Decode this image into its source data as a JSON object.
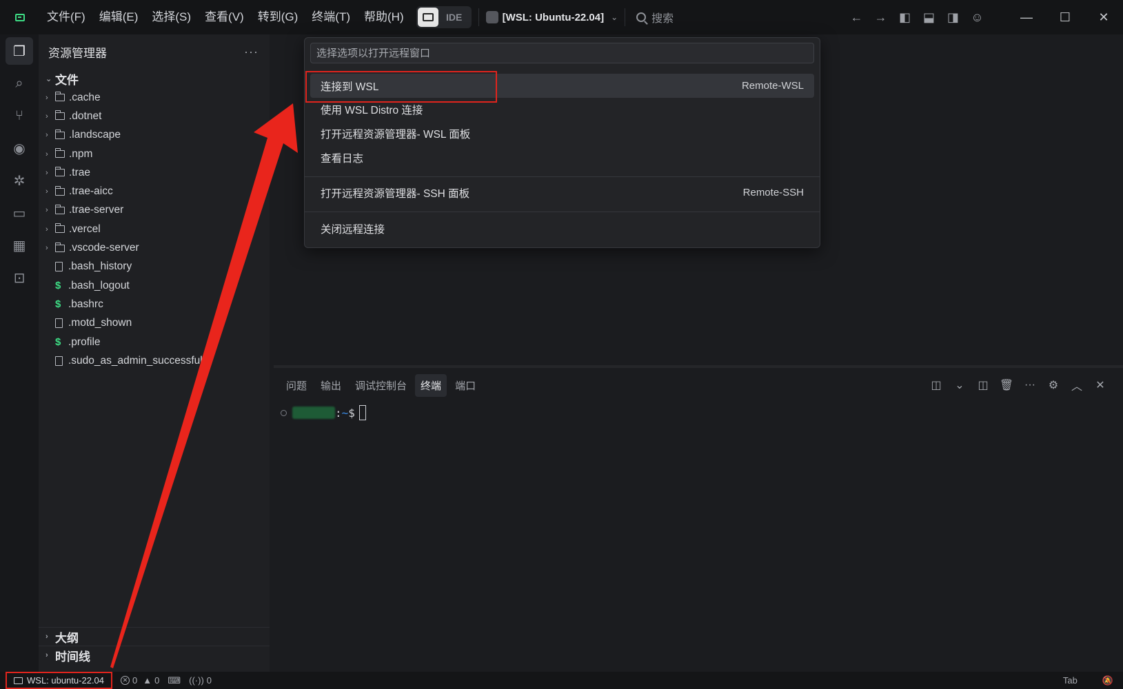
{
  "menu": [
    "文件(F)",
    "编辑(E)",
    "选择(S)",
    "查看(V)",
    "转到(G)",
    "终端(T)",
    "帮助(H)"
  ],
  "ide_label": "IDE",
  "project_name": "[WSL: Ubuntu-22.04]",
  "search_placeholder": "搜索",
  "sidebar": {
    "title": "资源管理器",
    "more": "···",
    "root": "文件",
    "items": [
      {
        "name": ".cache",
        "kind": "folder"
      },
      {
        "name": ".dotnet",
        "kind": "folder"
      },
      {
        "name": ".landscape",
        "kind": "folder"
      },
      {
        "name": ".npm",
        "kind": "folder"
      },
      {
        "name": ".trae",
        "kind": "folder"
      },
      {
        "name": ".trae-aicc",
        "kind": "folder"
      },
      {
        "name": ".trae-server",
        "kind": "folder"
      },
      {
        "name": ".vercel",
        "kind": "folder"
      },
      {
        "name": ".vscode-server",
        "kind": "folder"
      },
      {
        "name": ".bash_history",
        "kind": "file"
      },
      {
        "name": ".bash_logout",
        "kind": "shell"
      },
      {
        "name": ".bashrc",
        "kind": "shell"
      },
      {
        "name": ".motd_shown",
        "kind": "file"
      },
      {
        "name": ".profile",
        "kind": "shell"
      },
      {
        "name": ".sudo_as_admin_successful",
        "kind": "file"
      }
    ],
    "outline": "大纲",
    "timeline": "时间线"
  },
  "quickpick": {
    "placeholder": "选择选项以打开远程窗口",
    "items": [
      {
        "label": "连接到 WSL",
        "detail": "Remote-WSL"
      },
      {
        "label": "使用 WSL Distro 连接",
        "detail": ""
      },
      {
        "label": "打开远程资源管理器- WSL 面板",
        "detail": ""
      },
      {
        "label": "查看日志",
        "detail": ""
      },
      {
        "label": "打开远程资源管理器- SSH 面板",
        "detail": "Remote-SSH"
      },
      {
        "label": "关闭远程连接",
        "detail": ""
      }
    ]
  },
  "panel": {
    "tabs": [
      "问题",
      "输出",
      "调试控制台",
      "终端",
      "端口"
    ],
    "active_tab": "终端"
  },
  "terminal": {
    "colon": ":",
    "path": "~",
    "prompt": "$"
  },
  "status": {
    "remote": "WSL: ubuntu-22.04",
    "errors": "0",
    "warnings": "0",
    "ports": "0",
    "tab": "Tab"
  },
  "colors": {
    "accent": "#3ddc84",
    "annotation": "#e0241d"
  }
}
